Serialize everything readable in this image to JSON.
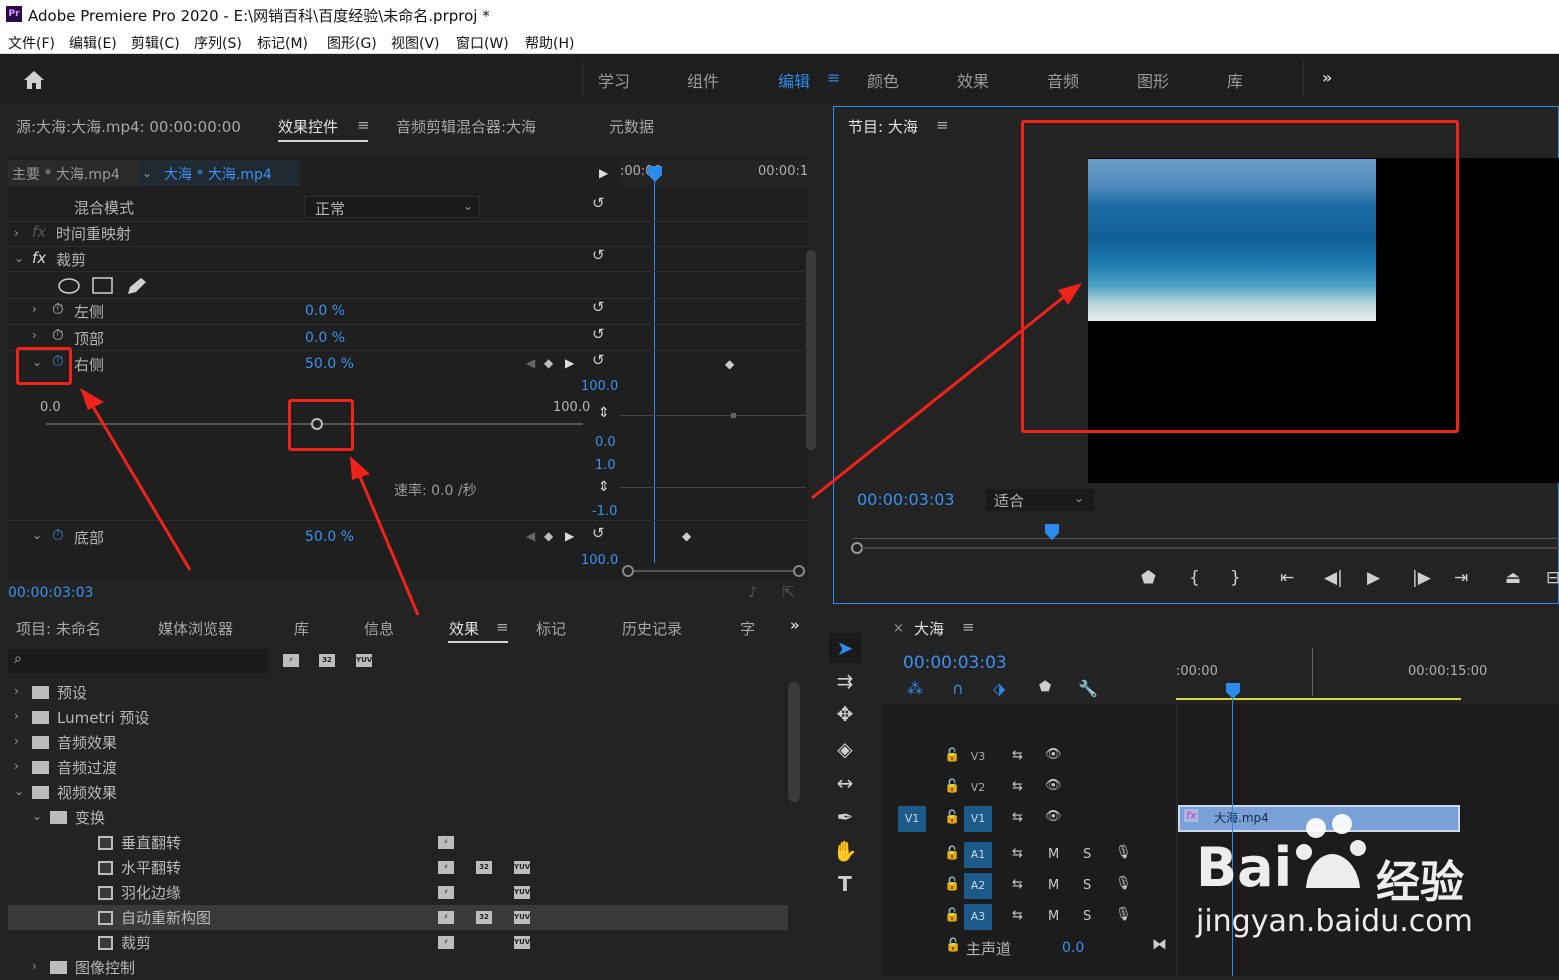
{
  "app": {
    "title": "Adobe Premiere Pro 2020 - E:\\网销百科\\百度经验\\未命名.prproj *",
    "logo": "Pr"
  },
  "menu": [
    "文件(F)",
    "编辑(E)",
    "剪辑(C)",
    "序列(S)",
    "标记(M)",
    "图形(G)",
    "视图(V)",
    "窗口(W)",
    "帮助(H)"
  ],
  "workspaces": [
    "学习",
    "组件",
    "编辑",
    "颜色",
    "效果",
    "音频",
    "图形",
    "库"
  ],
  "workspace_active": "编辑",
  "source_panel": {
    "tabs": [
      "源:大海:大海.mp4: 00:00:00:00",
      "效果控件",
      "音频剪辑混合器:大海",
      "元数据"
    ],
    "clip_main": "主要 * 大海.mp4",
    "clip_seq": "大海 * 大海.mp4",
    "time_start": ":00:00",
    "time_end": "00:00:1",
    "blend_label": "混合模式",
    "blend_value": "正常",
    "time_remap": "时间重映射",
    "crop_label": "裁剪",
    "left_label": "左侧",
    "left_value": "0.0 %",
    "top_label": "顶部",
    "top_value": "0.0 %",
    "right_label": "右侧",
    "right_value": "50.0 %",
    "slider_min": "0.0",
    "slider_max": "100.0",
    "graph_top": "100.0",
    "graph_zero": "0.0",
    "vel_top": "1.0",
    "vel_bottom": "-1.0",
    "rate": "速率: 0.0 /秒",
    "bottom_label": "底部",
    "bottom_value": "50.0 %",
    "bottom_graph_top": "100.0",
    "timecode": "00:00:03:03"
  },
  "program": {
    "title": "节目: 大海",
    "timecode": "00:00:03:03",
    "fit": "适合"
  },
  "project_panel": {
    "tabs": [
      "项目: 未命名",
      "媒体浏览器",
      "库",
      "信息",
      "效果",
      "标记",
      "历史记录",
      "字"
    ],
    "active": "效果",
    "items": [
      {
        "label": "预设",
        "level": 0,
        "type": "star-folder",
        "open": false
      },
      {
        "label": "Lumetri 预设",
        "level": 0,
        "type": "star-folder",
        "open": false
      },
      {
        "label": "音频效果",
        "level": 0,
        "type": "folder",
        "open": false
      },
      {
        "label": "音频过渡",
        "level": 0,
        "type": "folder",
        "open": false
      },
      {
        "label": "视频效果",
        "level": 0,
        "type": "folder",
        "open": true
      },
      {
        "label": "变换",
        "level": 1,
        "type": "folder",
        "open": true
      },
      {
        "label": "垂直翻转",
        "level": 2,
        "type": "effect"
      },
      {
        "label": "水平翻转",
        "level": 2,
        "type": "effect"
      },
      {
        "label": "羽化边缘",
        "level": 2,
        "type": "effect"
      },
      {
        "label": "自动重新构图",
        "level": 2,
        "type": "effect"
      },
      {
        "label": "裁剪",
        "level": 2,
        "type": "effect"
      },
      {
        "label": "图像控制",
        "level": 1,
        "type": "folder",
        "open": false
      }
    ],
    "badge_32": "32",
    "badge_yuv": "YUV"
  },
  "timeline": {
    "title": "大海",
    "timecode": "00:00:03:03",
    "ruler_start": ":00:00",
    "ruler_mid": "00:00:15:00",
    "tracks_video": [
      "V3",
      "V2",
      "V1"
    ],
    "tracks_audio": [
      "A1",
      "A2",
      "A3"
    ],
    "source_patch": "V1",
    "clip_name": "大海.mp4",
    "master_label": "主声道",
    "master_value": "0.0",
    "m": "M",
    "s": "S"
  },
  "watermark": {
    "line1": "Bai",
    "line2": "经验",
    "url": "jingyan.baidu.com"
  }
}
